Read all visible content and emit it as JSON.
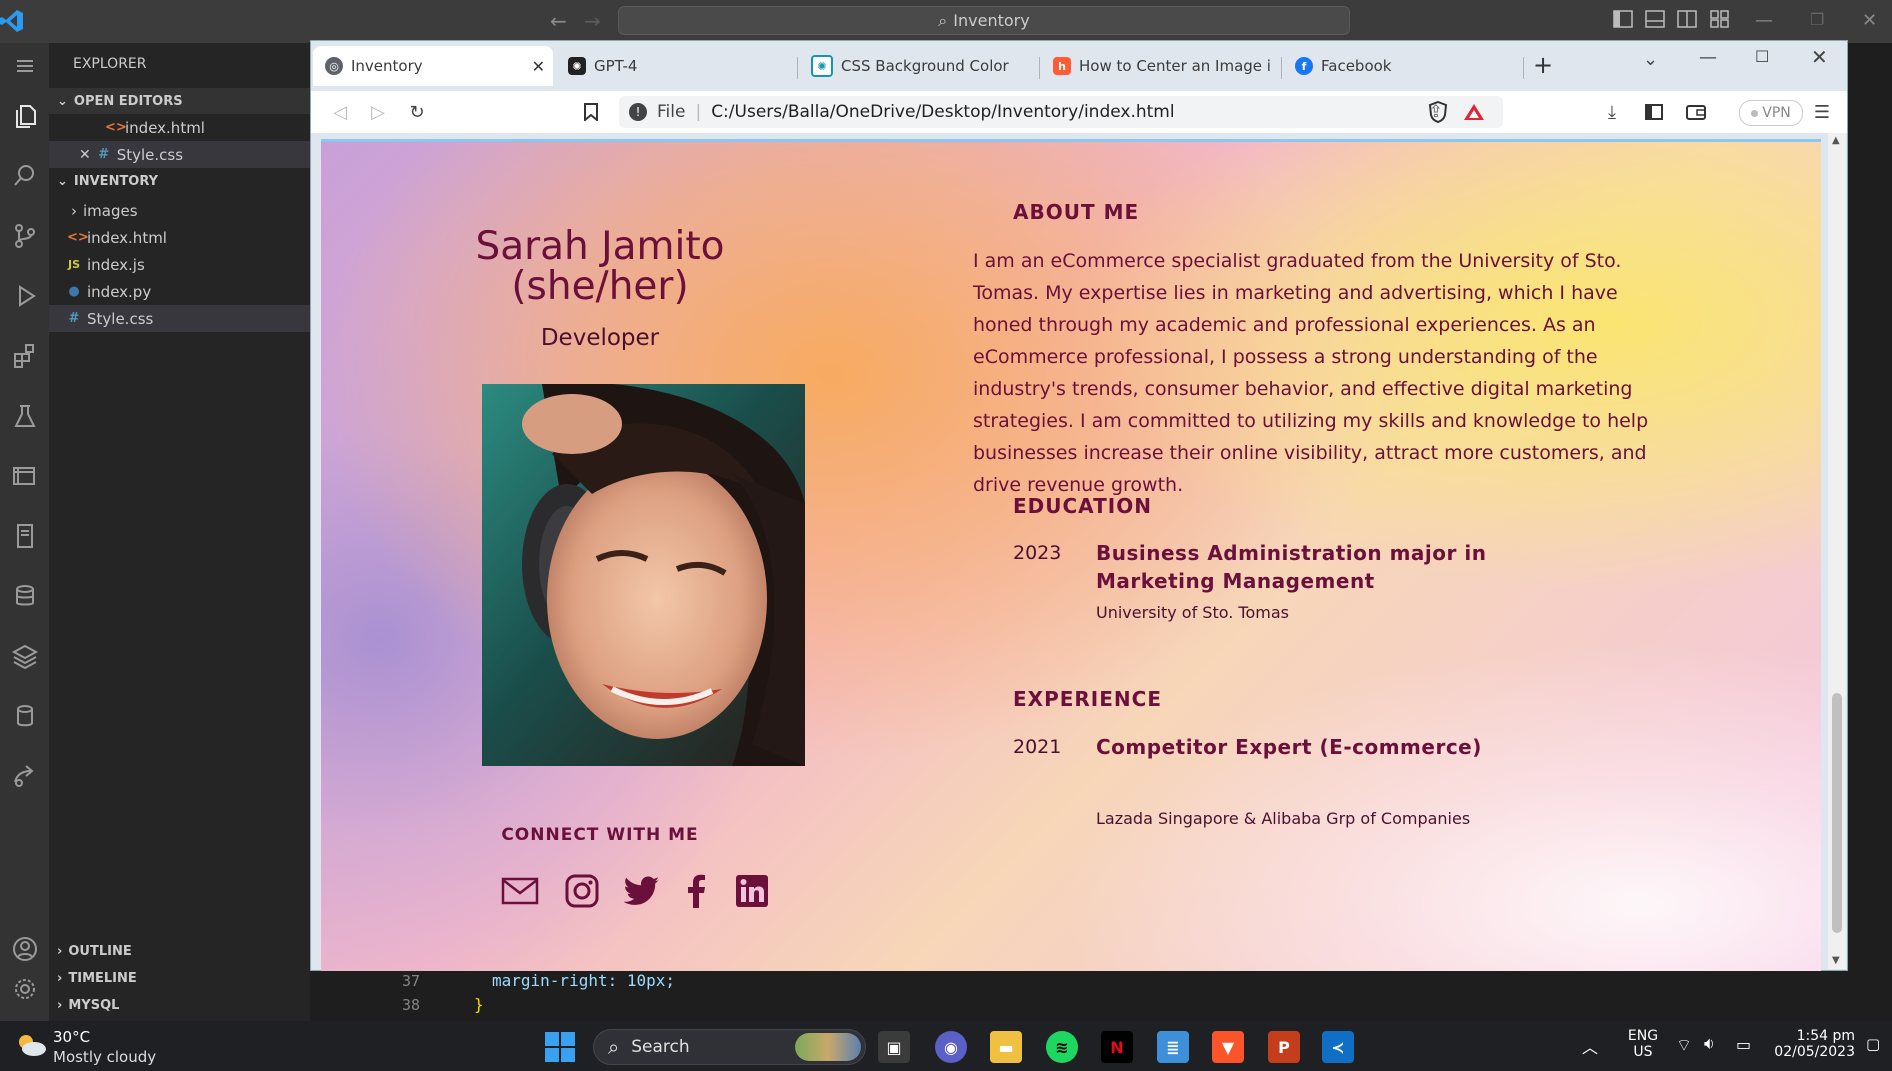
{
  "vscode": {
    "search_text": "Inventory",
    "explorer_title": "EXPLORER",
    "open_editors_label": "OPEN EDITORS",
    "open_editors": [
      {
        "name": "index.html",
        "icon": "html-icon"
      },
      {
        "name": "Style.css",
        "icon": "css-icon"
      }
    ],
    "folder_label": "INVENTORY",
    "files": [
      {
        "name": "images",
        "icon": "folder-icon"
      },
      {
        "name": "index.html",
        "icon": "html-icon"
      },
      {
        "name": "index.js",
        "icon": "js-icon"
      },
      {
        "name": "index.py",
        "icon": "python-icon"
      },
      {
        "name": "Style.css",
        "icon": "css-icon"
      }
    ],
    "bottom_sections": [
      "OUTLINE",
      "TIMELINE",
      "MYSQL"
    ],
    "code": {
      "line_37_num": "37",
      "line_37": "margin-right: 10px;",
      "line_38_num": "38",
      "line_38": "}"
    }
  },
  "browser": {
    "tabs": [
      {
        "label": "Inventory",
        "active": true
      },
      {
        "label": "GPT-4"
      },
      {
        "label": "CSS Background Color"
      },
      {
        "label": "How to Center an Image in H"
      },
      {
        "label": "Facebook"
      }
    ],
    "url_scheme": "File",
    "url": "C:/Users/Balla/OneDrive/Desktop/Inventory/index.html",
    "vpn_label": "VPN"
  },
  "profile": {
    "name_line1": "Sarah Jamito",
    "name_line2": "(she/her)",
    "role": "Developer",
    "connect_label": "CONNECT WITH ME",
    "social_icons": [
      "mail-icon",
      "instagram-icon",
      "twitter-icon",
      "facebook-icon",
      "linkedin-icon"
    ],
    "about_title": "ABOUT ME",
    "about_text": "I am an eCommerce specialist graduated from the University of Sto. Tomas. My expertise lies in marketing and advertising, which I have honed through my academic and professional experiences. As an eCommerce professional, I possess a strong understanding of the industry's trends, consumer behavior, and effective digital marketing strategies. I am committed to utilizing my skills and knowledge to help businesses increase their online visibility, attract more customers, and drive revenue growth.",
    "education_title": "EDUCATION",
    "education": {
      "year": "2023",
      "title": "Business Administration major in Marketing Management",
      "school": "University of Sto. Tomas"
    },
    "experience_title": "EXPERIENCE",
    "experience": {
      "year": "2021",
      "title": "Competitor Expert (E-commerce)",
      "company": "Lazada Singapore & Alibaba Grp of Companies"
    }
  },
  "taskbar": {
    "weather_temp": "30°C",
    "weather_desc": "Mostly cloudy",
    "search_label": "Search",
    "lang_line1": "ENG",
    "lang_line2": "US",
    "time": "1:54 pm",
    "date": "02/05/2023"
  },
  "colors": {
    "accent": "#6b0f3b",
    "vscode_bg": "#1e1e1e",
    "taskbar": "#1f2024"
  }
}
